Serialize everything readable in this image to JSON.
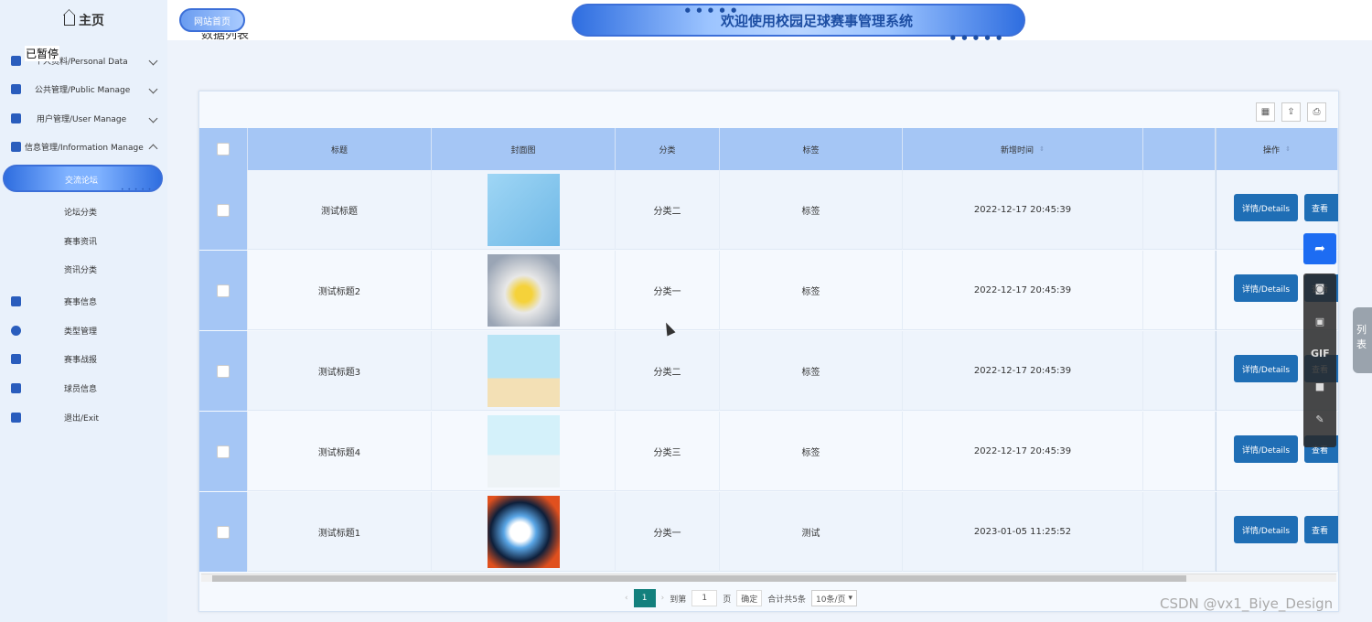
{
  "sidebar": {
    "home_label": "主页",
    "overlay_label": "已暂停",
    "menus": [
      {
        "label": "个人资料/Personal Data",
        "icon": "document-icon",
        "expanded": false
      },
      {
        "label": "公共管理/Public Manage",
        "icon": "clipboard-icon",
        "expanded": false
      },
      {
        "label": "用户管理/User Manage",
        "icon": "users-icon",
        "expanded": false
      },
      {
        "label": "信息管理/Information Manage",
        "icon": "chart-icon",
        "expanded": true
      }
    ],
    "sub_items": [
      "交流论坛",
      "论坛分类",
      "赛事资讯",
      "资讯分类"
    ],
    "other_items": [
      {
        "label": "赛事信息",
        "icon": "bookmark-icon"
      },
      {
        "label": "类型管理",
        "icon": "user-circle-icon"
      },
      {
        "label": "赛事战报",
        "icon": "calendar-icon"
      },
      {
        "label": "球员信息",
        "icon": "calendar-check-icon"
      },
      {
        "label": "退出/Exit",
        "icon": "book-icon"
      }
    ]
  },
  "header": {
    "site_home": "网站首页",
    "banner_title": "欢迎使用校园足球赛事管理系统"
  },
  "page": {
    "cut_label": "数据列表"
  },
  "table": {
    "headers": [
      "标题",
      "封面图",
      "分类",
      "标签",
      "新增时间",
      "",
      "操作"
    ],
    "rows": [
      {
        "title": "测试标题",
        "category": "分类二",
        "tag": "标签",
        "time": "2022-12-17 20:45:39",
        "thumb_color": "#8ec9ef"
      },
      {
        "title": "测试标题2",
        "category": "分类一",
        "tag": "标签",
        "time": "2022-12-17 20:45:39",
        "thumb_color": "#f2f2f2"
      },
      {
        "title": "测试标题3",
        "category": "分类二",
        "tag": "标签",
        "time": "2022-12-17 20:45:39",
        "thumb_color": "#a9dcef"
      },
      {
        "title": "测试标题4",
        "category": "分类三",
        "tag": "标签",
        "time": "2022-12-17 20:45:39",
        "thumb_color": "#c6ecf7"
      },
      {
        "title": "测试标题1",
        "category": "分类一",
        "tag": "测试",
        "time": "2023-01-05 11:25:52",
        "thumb_color": "#0e1f3a"
      }
    ],
    "detail_label": "详情/Details",
    "view_label": "查看"
  },
  "pagination": {
    "current": "1",
    "goto_prefix": "到第",
    "goto_value": "1",
    "page_suffix": "页",
    "confirm": "确定",
    "total": "合计共5条",
    "page_size": "10条/页"
  },
  "side_tab": "列表",
  "watermark": "CSDN @vx1_Biye_Design",
  "colors": {
    "accent": "#1f6eb5",
    "header_row": "#a5c6f5",
    "pager_active": "#13807d"
  }
}
